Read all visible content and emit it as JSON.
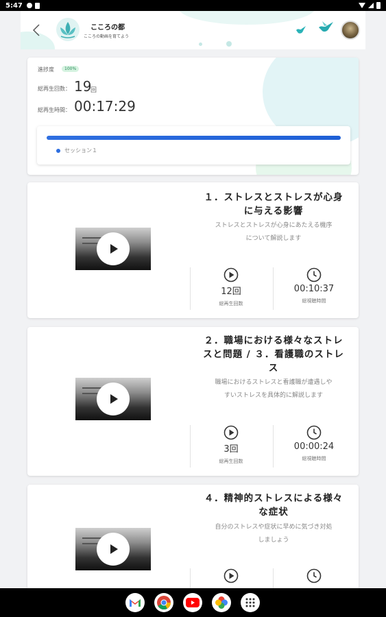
{
  "status_bar": {
    "time": "5:47"
  },
  "header": {
    "app_title": "こころの都",
    "app_subtitle": "こころの動画を育てよう"
  },
  "summary": {
    "progress_label": "進捗度",
    "progress_badge": "100%",
    "progress_fraction": 1.0,
    "total_plays_label": "総再生回数：",
    "total_plays_value": "19",
    "total_plays_unit": "回",
    "total_time_label": "総再生時間：",
    "total_time_value": "00:17:29",
    "session_name": "セッション１"
  },
  "lessons": [
    {
      "title_line1": "１．ストレスとストレスが心身",
      "title_line2": "に与える影響",
      "desc_line1": "ストレスとストレスが心身にあたえる機序",
      "desc_line2": "について解説します",
      "plays_value": "12回",
      "plays_label": "総再生回数",
      "time_value": "00:10:37",
      "time_label": "総視聴時間"
    },
    {
      "title_line1": "２．職場における様々なストレ",
      "title_line2": "スと問題 / ３．看護職のストレ",
      "title_line3": "ス",
      "desc_line1": "職場におけるストレスと看護職が遭遇しや",
      "desc_line2": "すいストレスを具体的に解説します",
      "plays_value": "3回",
      "plays_label": "総再生回数",
      "time_value": "00:00:24",
      "time_label": "総視聴時間"
    },
    {
      "title_line1": "４．精神的ストレスによる様々",
      "title_line2": "な症状",
      "desc_line1": "自分のストレスや症状に早めに気づき対処",
      "desc_line2": "しましょう"
    }
  ],
  "colors": {
    "accent_blue": "#2f6fe0",
    "teal": "#2bb3b8"
  },
  "dock": [
    "gmail-icon",
    "chrome-icon",
    "youtube-icon",
    "photos-icon",
    "apps-icon"
  ]
}
